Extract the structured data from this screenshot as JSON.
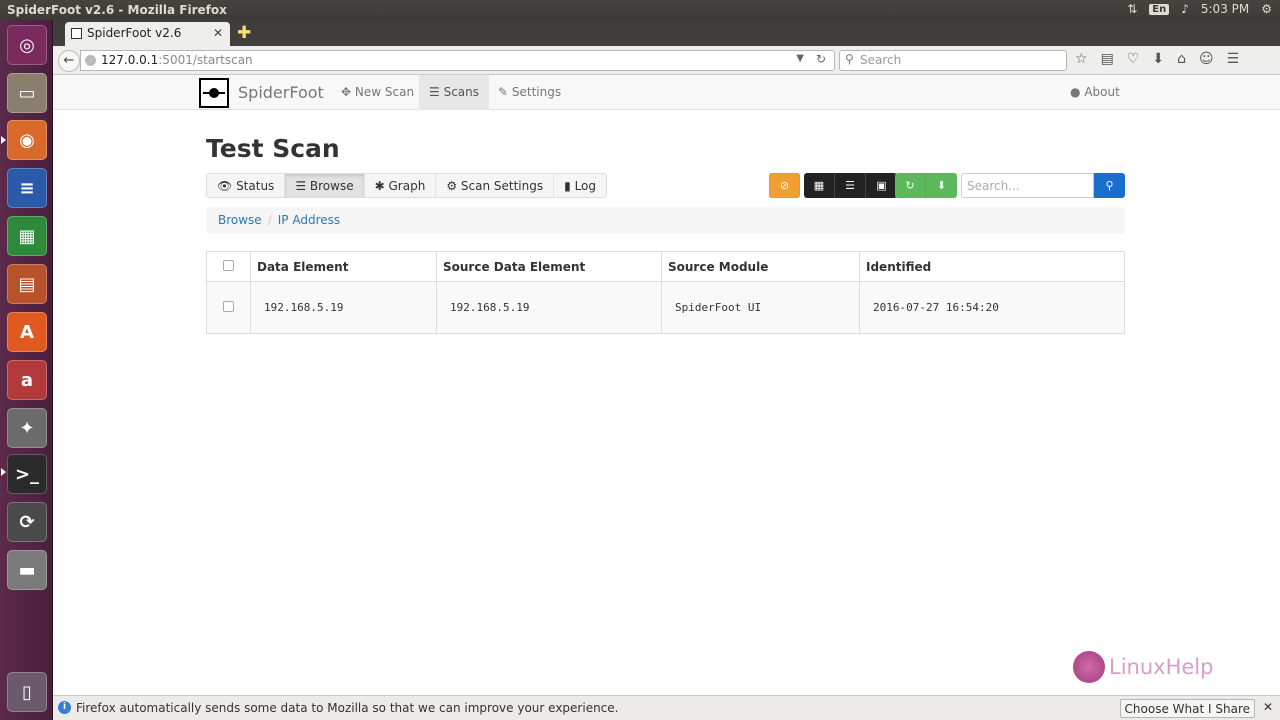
{
  "os": {
    "window_title": "SpiderFoot v2.6 - Mozilla Firefox",
    "keyboard": "En",
    "clock": "5:03 PM"
  },
  "browser": {
    "tab_title": "SpiderFoot v2.6",
    "url_host": "127.0.0.1",
    "url_path": ":5001/startscan",
    "search_placeholder": "Search"
  },
  "sf_nav": {
    "brand": "SpiderFoot",
    "new_scan": "New Scan",
    "scans": "Scans",
    "settings": "Settings",
    "about": "About"
  },
  "main": {
    "title": "Test Scan",
    "tabs": [
      "Status",
      "Browse",
      "Graph",
      "Scan Settings",
      "Log"
    ],
    "search_placeholder": "Search...",
    "breadcrumb": [
      "Browse",
      "IP Address"
    ]
  },
  "table": {
    "headers": [
      "Data Element",
      "Source Data Element",
      "Source Module",
      "Identified"
    ],
    "rows": [
      [
        "192.168.5.19",
        "192.168.5.19",
        "SpiderFoot UI",
        "2016-07-27 16:54:20"
      ]
    ]
  },
  "notification": {
    "message": "Firefox automatically sends some data to Mozilla so that we can improve your experience.",
    "button": "Choose What I Share"
  },
  "watermark": "LinuxHelp",
  "colors": {
    "launcher": "#5c2a4a",
    "warn": "#f0a030",
    "success": "#5cb85c",
    "primary": "#1a6fce",
    "link": "#2a7ab8"
  }
}
